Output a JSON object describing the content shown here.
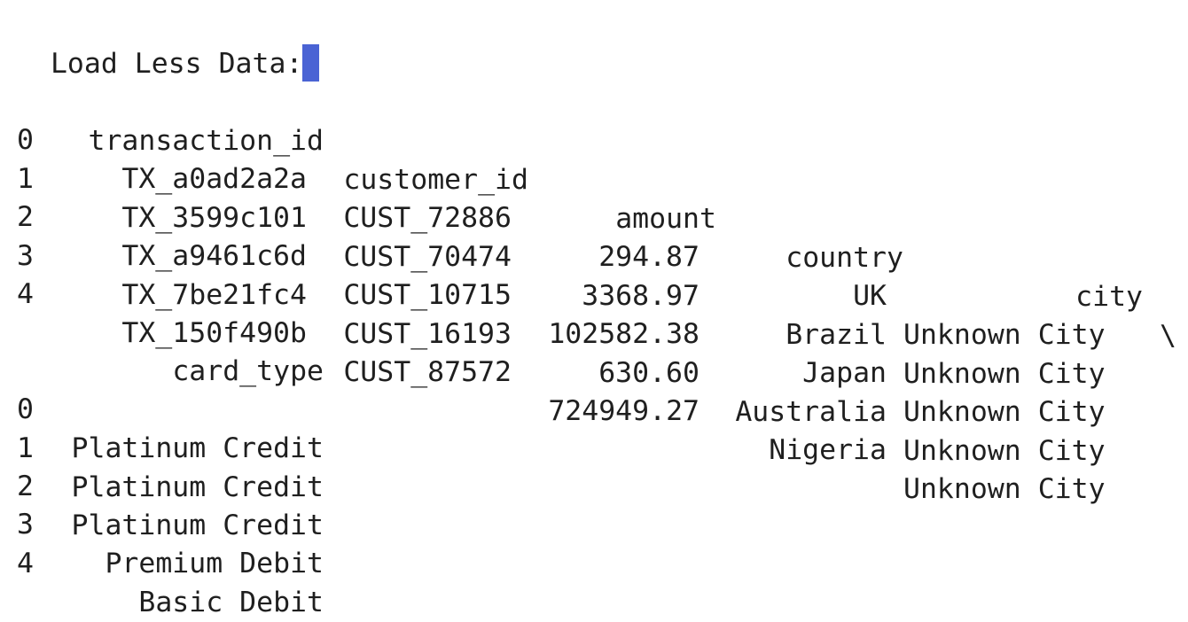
{
  "prompt_text": "Load Less Data:",
  "table1": {
    "headers": [
      "transaction_id",
      "customer_id",
      "amount",
      "country",
      "city"
    ],
    "continuation_marker": "\\",
    "rows": [
      {
        "index": "0",
        "transaction_id": "TX_a0ad2a2a",
        "customer_id": "CUST_72886",
        "amount": "294.87",
        "country": "UK",
        "city": "Unknown City"
      },
      {
        "index": "1",
        "transaction_id": "TX_3599c101",
        "customer_id": "CUST_70474",
        "amount": "3368.97",
        "country": "Brazil",
        "city": "Unknown City"
      },
      {
        "index": "2",
        "transaction_id": "TX_a9461c6d",
        "customer_id": "CUST_10715",
        "amount": "102582.38",
        "country": "Japan",
        "city": "Unknown City"
      },
      {
        "index": "3",
        "transaction_id": "TX_7be21fc4",
        "customer_id": "CUST_16193",
        "amount": "630.60",
        "country": "Australia",
        "city": "Unknown City"
      },
      {
        "index": "4",
        "transaction_id": "TX_150f490b",
        "customer_id": "CUST_87572",
        "amount": "724949.27",
        "country": "Nigeria",
        "city": "Unknown City"
      }
    ]
  },
  "table2": {
    "headers": [
      "card_type"
    ],
    "rows": [
      {
        "index": "0",
        "card_type": "Platinum Credit"
      },
      {
        "index": "1",
        "card_type": "Platinum Credit"
      },
      {
        "index": "2",
        "card_type": "Platinum Credit"
      },
      {
        "index": "3",
        "card_type": "Premium Debit"
      },
      {
        "index": "4",
        "card_type": "Basic Debit"
      }
    ]
  }
}
